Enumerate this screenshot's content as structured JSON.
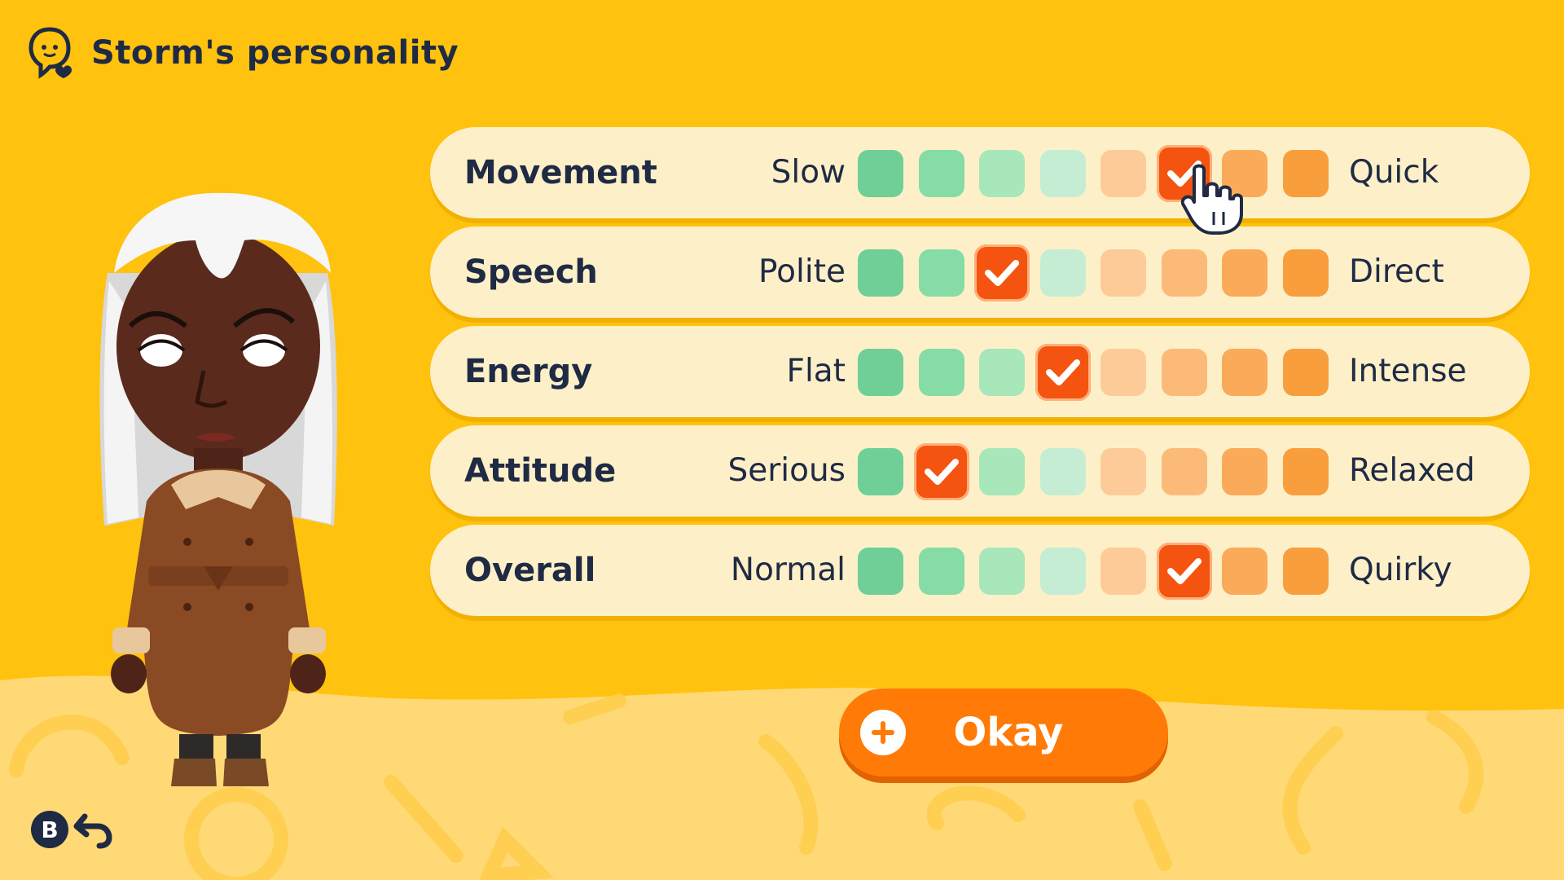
{
  "header": {
    "title": "Storm's personality",
    "icon": "head-heart-icon"
  },
  "colors": {
    "background": "#FFC20E",
    "row_background": "#FDF0C8",
    "selected": "#F4540F",
    "button": "#FF7A06",
    "scale": [
      "#6FCF97",
      "#86DCA5",
      "#A7E7BA",
      "#C4EDD4",
      "#FDCB98",
      "#FCBA78",
      "#FAAA58",
      "#F99E3D"
    ]
  },
  "traits": [
    {
      "label": "Movement",
      "left": "Slow",
      "right": "Quick",
      "selected_index": 5
    },
    {
      "label": "Speech",
      "left": "Polite",
      "right": "Direct",
      "selected_index": 2
    },
    {
      "label": "Energy",
      "left": "Flat",
      "right": "Intense",
      "selected_index": 3
    },
    {
      "label": "Attitude",
      "left": "Serious",
      "right": "Relaxed",
      "selected_index": 1
    },
    {
      "label": "Overall",
      "left": "Normal",
      "right": "Quirky",
      "selected_index": 5
    }
  ],
  "scale_steps": 8,
  "okay_button": {
    "label": "Okay",
    "icon": "plus-icon"
  },
  "back": {
    "button_glyph": "B",
    "icon": "back-arrow-icon"
  }
}
